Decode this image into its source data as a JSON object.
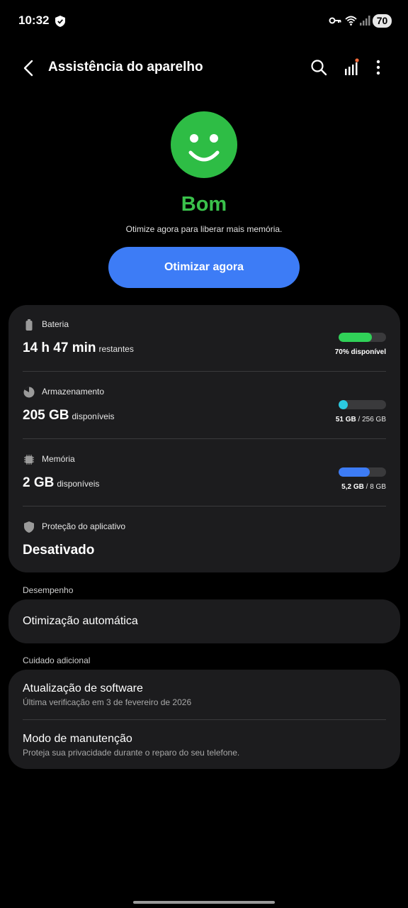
{
  "status_bar": {
    "time": "10:32",
    "battery": "70"
  },
  "header": {
    "title": "Assistência do aparelho"
  },
  "summary": {
    "status": "Bom",
    "description": "Otimize agora para liberar mais memória.",
    "optimize_label": "Otimizar agora"
  },
  "device": {
    "battery": {
      "label": "Bateria",
      "value": "14 h 47 min",
      "unit": "restantes",
      "caption": "70% disponível",
      "fraction": 0.7,
      "color": "#30d158"
    },
    "storage": {
      "label": "Armazenamento",
      "value": "205 GB",
      "unit": "disponíveis",
      "used": "51 GB",
      "total": "/ 256 GB",
      "fraction": 0.2,
      "color": "#2bc9e0"
    },
    "memory": {
      "label": "Memória",
      "value": "2 GB",
      "unit": "disponíveis",
      "used": "5,2 GB",
      "total": "/ 8 GB",
      "fraction": 0.65,
      "color": "#3d7cf6"
    },
    "app_protection": {
      "label": "Proteção do aplicativo",
      "value": "Desativado"
    }
  },
  "performance": {
    "section_title": "Desempenho",
    "auto_optimization": "Otimização automática"
  },
  "additional_care": {
    "section_title": "Cuidado adicional",
    "software_update": {
      "title": "Atualização de software",
      "subtitle": "Última verificação em 3 de fevereiro de 2026"
    },
    "maintenance_mode": {
      "title": "Modo de manutenção",
      "subtitle": "Proteja sua privacidade durante o reparo do seu telefone."
    }
  }
}
